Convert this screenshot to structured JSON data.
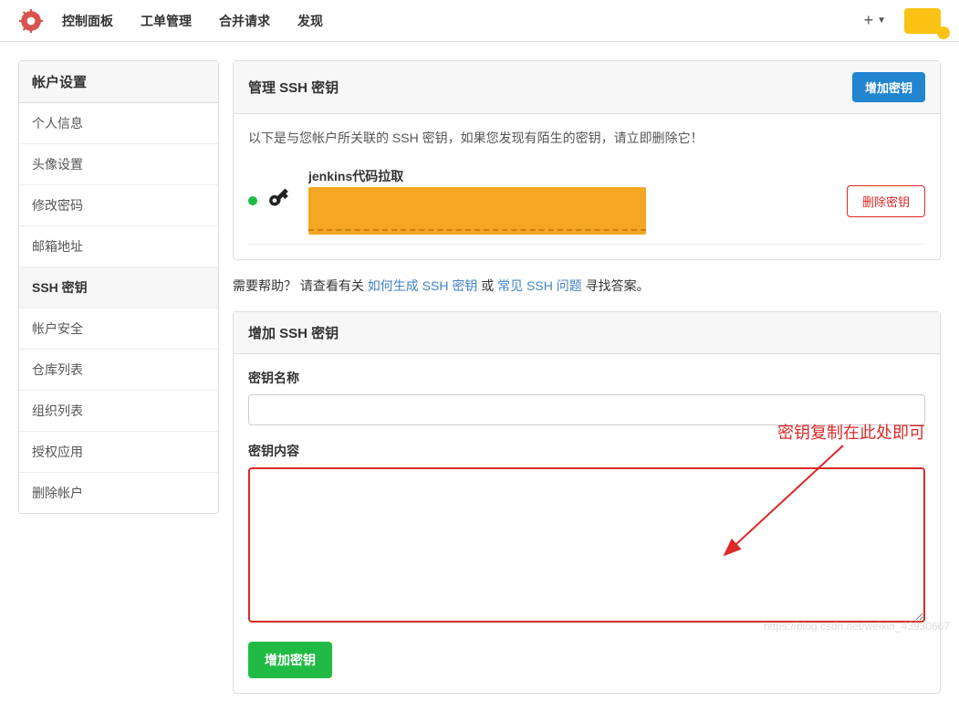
{
  "nav": {
    "items": [
      "控制面板",
      "工单管理",
      "合并请求",
      "发现"
    ]
  },
  "sidebar": {
    "header": "帐户设置",
    "items": [
      "个人信息",
      "头像设置",
      "修改密码",
      "邮箱地址",
      "SSH 密钥",
      "帐户安全",
      "仓库列表",
      "组织列表",
      "授权应用",
      "删除帐户"
    ],
    "active_index": 4
  },
  "ssh_manage": {
    "title": "管理 SSH 密钥",
    "add_button": "增加密钥",
    "description": "以下是与您帐户所关联的 SSH 密钥，如果您发现有陌生的密钥，请立即删除它！",
    "keys": [
      {
        "name": "jenkins代码拉取",
        "delete_label": "删除密钥"
      }
    ]
  },
  "help": {
    "prefix": "需要帮助？  请查看有关 ",
    "link1": "如何生成 SSH 密钥",
    "mid": " 或 ",
    "link2": "常见 SSH 问题",
    "suffix": " 寻找答案。"
  },
  "ssh_add": {
    "title": "增加 SSH 密钥",
    "name_label": "密钥名称",
    "content_label": "密钥内容",
    "submit": "增加密钥"
  },
  "annotation": {
    "text": "密钥复制在此处即可"
  },
  "watermark": "https://blog.csdn.net/weixin_43930667"
}
